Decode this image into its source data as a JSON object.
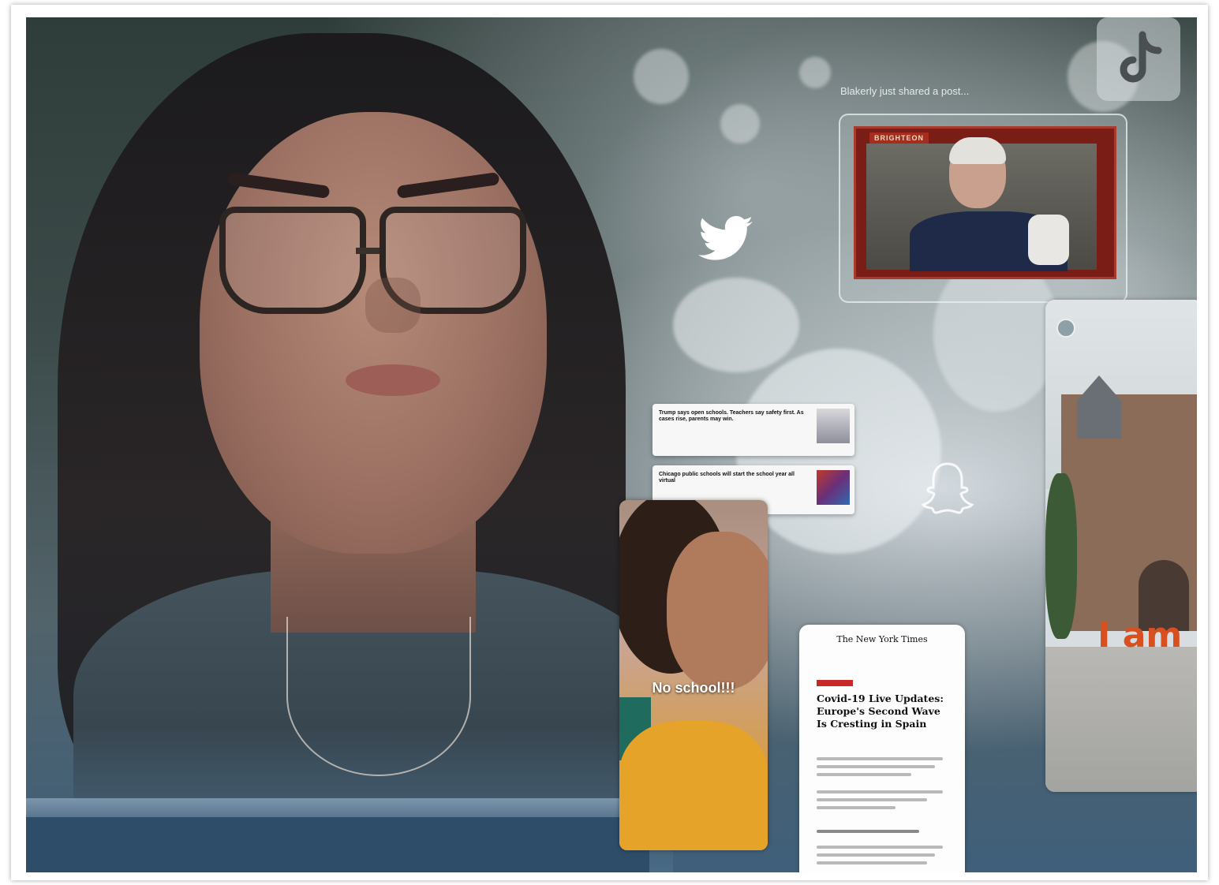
{
  "notification": {
    "shared_post": "Blakerly just shared a post..."
  },
  "video": {
    "badge": "BRIGHTEON",
    "bg_color": "#7a1d16"
  },
  "news_cards": [
    {
      "source": "",
      "headline": "Trump says open schools. Teachers say safety first. As cases rise, parents may win.",
      "body": ""
    },
    {
      "source": "",
      "headline": "Chicago public schools will start the school year all virtual",
      "body": ""
    }
  ],
  "story": {
    "caption": "No school!!!"
  },
  "nyt": {
    "masthead": "The New York Times",
    "headline": "Covid-19 Live Updates: Europe's Second Wave Is Cresting in Spain"
  },
  "ams": {
    "sign": "I am"
  },
  "icons": {
    "tiktok": "tiktok-icon",
    "twitter": "twitter-icon",
    "snapchat": "snapchat-icon"
  }
}
